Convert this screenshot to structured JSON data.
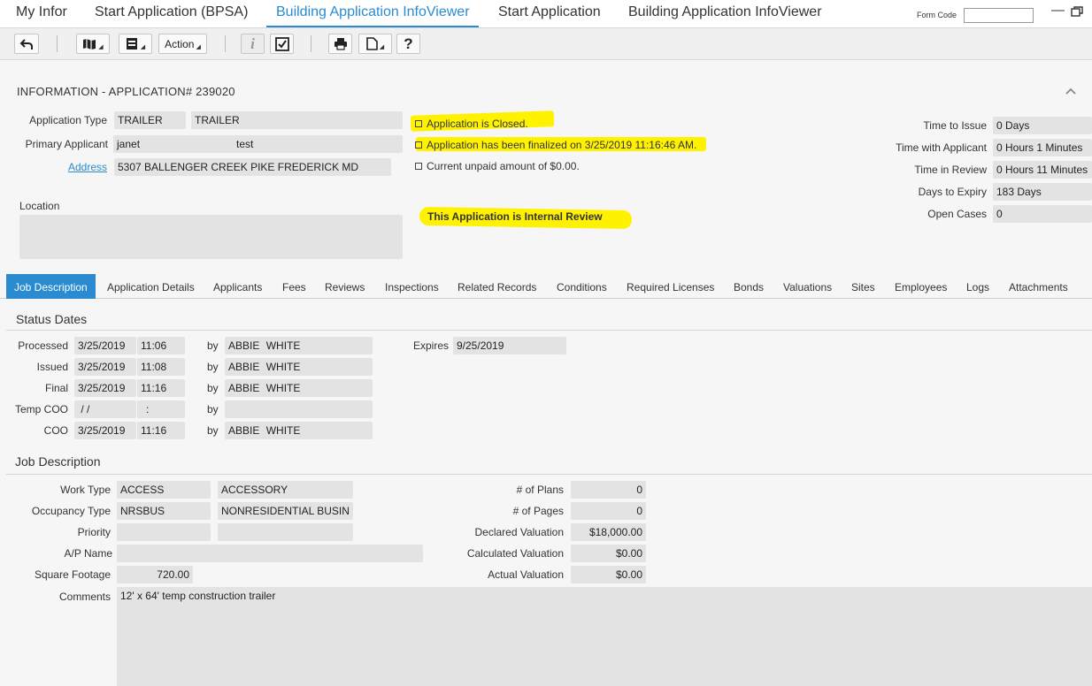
{
  "top_tabs": [
    {
      "label": "My Infor"
    },
    {
      "label": "Start Application (BPSA)"
    },
    {
      "label": "Building Application InfoViewer"
    },
    {
      "label": "Start Application"
    },
    {
      "label": "Building Application InfoViewer"
    }
  ],
  "form_code": {
    "label": "Form Code",
    "value": ""
  },
  "toolbar": {
    "action_label": "Action"
  },
  "info": {
    "title": "INFORMATION - APPLICATION# 239020",
    "application_type_label": "Application Type",
    "application_type_code": "TRAILER",
    "application_type_desc": "TRAILER",
    "primary_applicant_label": "Primary Applicant",
    "applicant_first": "janet",
    "applicant_last": "test",
    "address_label": "Address",
    "address_value": "5307 BALLENGER CREEK PIKE FREDERICK MD",
    "location_label": "Location",
    "location_value": ""
  },
  "messages": {
    "closed": "Application is Closed.",
    "finalized": "Application has been finalized on 3/25/2019 11:16:46 AM.",
    "unpaid": "Current unpaid amount of $0.00.",
    "internal_review": "This Application is Internal Review"
  },
  "metrics": [
    {
      "label": "Time to Issue",
      "value": "0 Days"
    },
    {
      "label": "Time with Applicant",
      "value": "0 Hours 1 Minutes"
    },
    {
      "label": "Time in Review",
      "value": "0 Hours 11 Minutes"
    },
    {
      "label": "Days to Expiry",
      "value": "183 Days"
    },
    {
      "label": "Open Cases",
      "value": "0"
    }
  ],
  "tabs": [
    {
      "label": "Job Description"
    },
    {
      "label": "Application Details"
    },
    {
      "label": "Applicants"
    },
    {
      "label": "Fees"
    },
    {
      "label": "Reviews"
    },
    {
      "label": "Inspections"
    },
    {
      "label": "Related Records"
    },
    {
      "label": "Conditions"
    },
    {
      "label": "Required Licenses"
    },
    {
      "label": "Bonds"
    },
    {
      "label": "Valuations"
    },
    {
      "label": "Sites"
    },
    {
      "label": "Employees"
    },
    {
      "label": "Logs"
    },
    {
      "label": "Attachments"
    }
  ],
  "status_dates": {
    "title": "Status Dates",
    "by_label": "by",
    "rows": [
      {
        "label": "Processed",
        "date": "3/25/2019",
        "time": "11:06",
        "by_first": "ABBIE",
        "by_last": "WHITE"
      },
      {
        "label": "Issued",
        "date": "3/25/2019",
        "time": "11:08",
        "by_first": "ABBIE",
        "by_last": "WHITE"
      },
      {
        "label": "Final",
        "date": "3/25/2019",
        "time": "11:16",
        "by_first": "ABBIE",
        "by_last": "WHITE"
      },
      {
        "label": "Temp COO",
        "date": " / /",
        "time": ":",
        "by_first": "",
        "by_last": ""
      },
      {
        "label": "COO",
        "date": "3/25/2019",
        "time": "11:16",
        "by_first": "ABBIE",
        "by_last": "WHITE"
      }
    ],
    "expires_label": "Expires",
    "expires_value": "9/25/2019"
  },
  "job": {
    "title": "Job Description",
    "work_type_label": "Work Type",
    "work_type_code": "ACCESS",
    "work_type_desc": "ACCESSORY",
    "occupancy_type_label": "Occupancy Type",
    "occupancy_type_code": "NRSBUS",
    "occupancy_type_desc": "NONRESIDENTIAL BUSIN",
    "priority_label": "Priority",
    "ap_name_label": "A/P Name",
    "square_footage_label": "Square Footage",
    "square_footage_value": "720.00",
    "comments_label": "Comments",
    "comments_value": "12' x 64' temp construction trailer",
    "num_plans_label": "# of Plans",
    "num_plans_value": "0",
    "num_pages_label": "# of Pages",
    "num_pages_value": "0",
    "declared_valuation_label": "Declared Valuation",
    "declared_valuation_value": "$18,000.00",
    "calculated_valuation_label": "Calculated Valuation",
    "calculated_valuation_value": "$0.00",
    "actual_valuation_label": "Actual Valuation",
    "actual_valuation_value": "$0.00"
  },
  "colors": {
    "accent": "#2a8bd0",
    "highlight": "#fff200",
    "field_bg": "#e3e3e3"
  }
}
